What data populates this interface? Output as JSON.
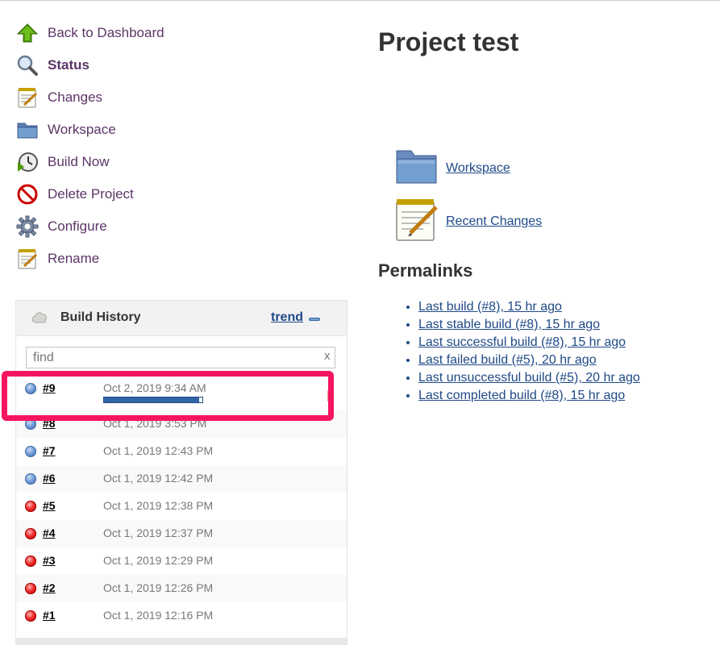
{
  "tasks": [
    {
      "label": "Back to Dashboard",
      "icon": "up-arrow-icon"
    },
    {
      "label": "Status",
      "icon": "magnifier-icon"
    },
    {
      "label": "Changes",
      "icon": "notepad-icon"
    },
    {
      "label": "Workspace",
      "icon": "folder-icon"
    },
    {
      "label": "Build Now",
      "icon": "clock-icon"
    },
    {
      "label": "Delete Project",
      "icon": "no-entry-icon"
    },
    {
      "label": "Configure",
      "icon": "gear-icon"
    },
    {
      "label": "Rename",
      "icon": "notepad-icon"
    }
  ],
  "build_history": {
    "title": "Build History",
    "trend_label": "trend",
    "filter_placeholder": "find",
    "clear_label": "x",
    "builds": [
      {
        "number": "#9",
        "date": "Oct 2, 2019 9:34 AM",
        "status": "blue",
        "in_progress": true,
        "progress_percent": 97
      },
      {
        "number": "#8",
        "date": "Oct 1, 2019 3:53 PM",
        "status": "blue"
      },
      {
        "number": "#7",
        "date": "Oct 1, 2019 12:43 PM",
        "status": "blue"
      },
      {
        "number": "#6",
        "date": "Oct 1, 2019 12:42 PM",
        "status": "blue"
      },
      {
        "number": "#5",
        "date": "Oct 1, 2019 12:38 PM",
        "status": "red"
      },
      {
        "number": "#4",
        "date": "Oct 1, 2019 12:37 PM",
        "status": "red"
      },
      {
        "number": "#3",
        "date": "Oct 1, 2019 12:29 PM",
        "status": "red"
      },
      {
        "number": "#2",
        "date": "Oct 1, 2019 12:26 PM",
        "status": "red"
      },
      {
        "number": "#1",
        "date": "Oct 1, 2019 12:16 PM",
        "status": "red"
      }
    ]
  },
  "main": {
    "title": "Project test",
    "workspace_link": "Workspace",
    "recent_changes_link": "Recent Changes",
    "permalinks_title": "Permalinks",
    "permalinks": [
      "Last build (#8), 15 hr ago",
      "Last stable build (#8), 15 hr ago",
      "Last successful build (#8), 15 hr ago",
      "Last failed build (#5), 20 hr ago",
      "Last unsuccessful build (#5), 20 hr ago",
      "Last completed build (#8), 15 hr ago"
    ]
  },
  "colors": {
    "link": "#204a87",
    "task_link": "#5c3566",
    "highlight": "#f5155e",
    "status_blue": "#3465a4",
    "status_red": "#ef2929"
  }
}
